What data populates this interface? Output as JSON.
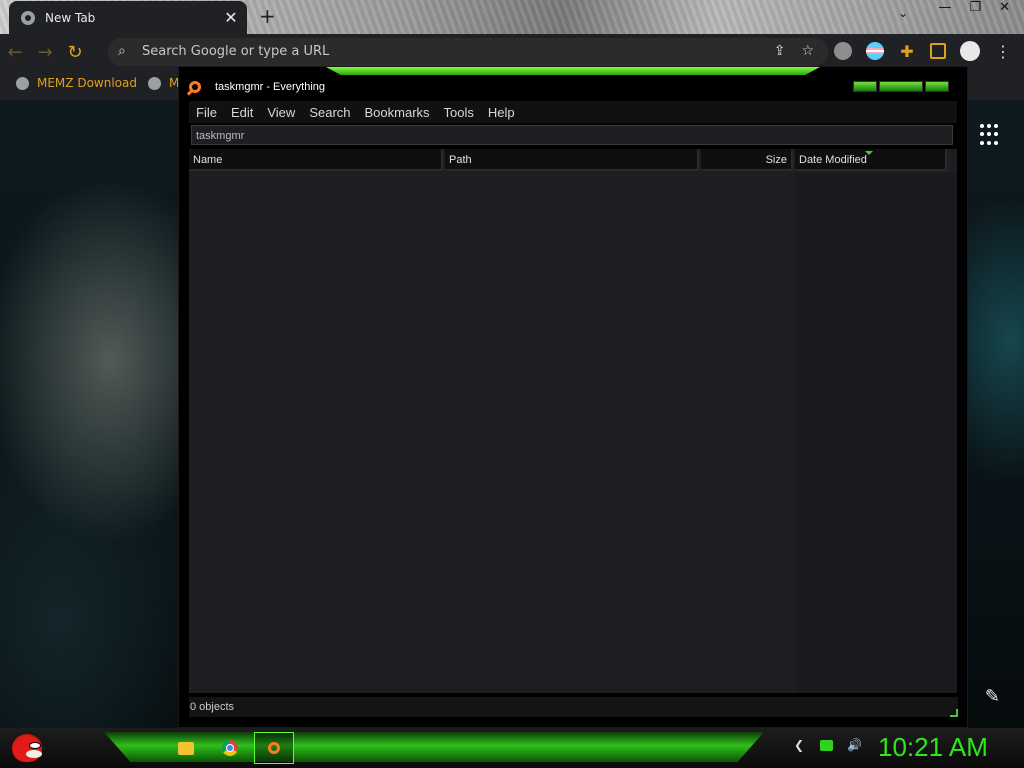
{
  "browser": {
    "tab": {
      "title": "New Tab"
    },
    "omnibox": {
      "placeholder": "Search Google or type a URL"
    },
    "bookmarks": [
      {
        "label": "MEMZ Download"
      },
      {
        "label": "M"
      }
    ],
    "accent_color": "#e0a11a"
  },
  "everything_window": {
    "title": "taskmgmr - Everything",
    "menu": [
      "File",
      "Edit",
      "View",
      "Search",
      "Bookmarks",
      "Tools",
      "Help"
    ],
    "search_value": "taskmgmr",
    "columns": {
      "name": "Name",
      "path": "Path",
      "size": "Size",
      "date_modified": "Date Modified"
    },
    "status": "0 objects",
    "accent_color": "#3ed12a"
  },
  "taskbar": {
    "clock": "10:21 AM",
    "clock_color": "#2ee81c",
    "apps": [
      "folder-icon",
      "chrome-icon",
      "everything-search-icon"
    ]
  }
}
